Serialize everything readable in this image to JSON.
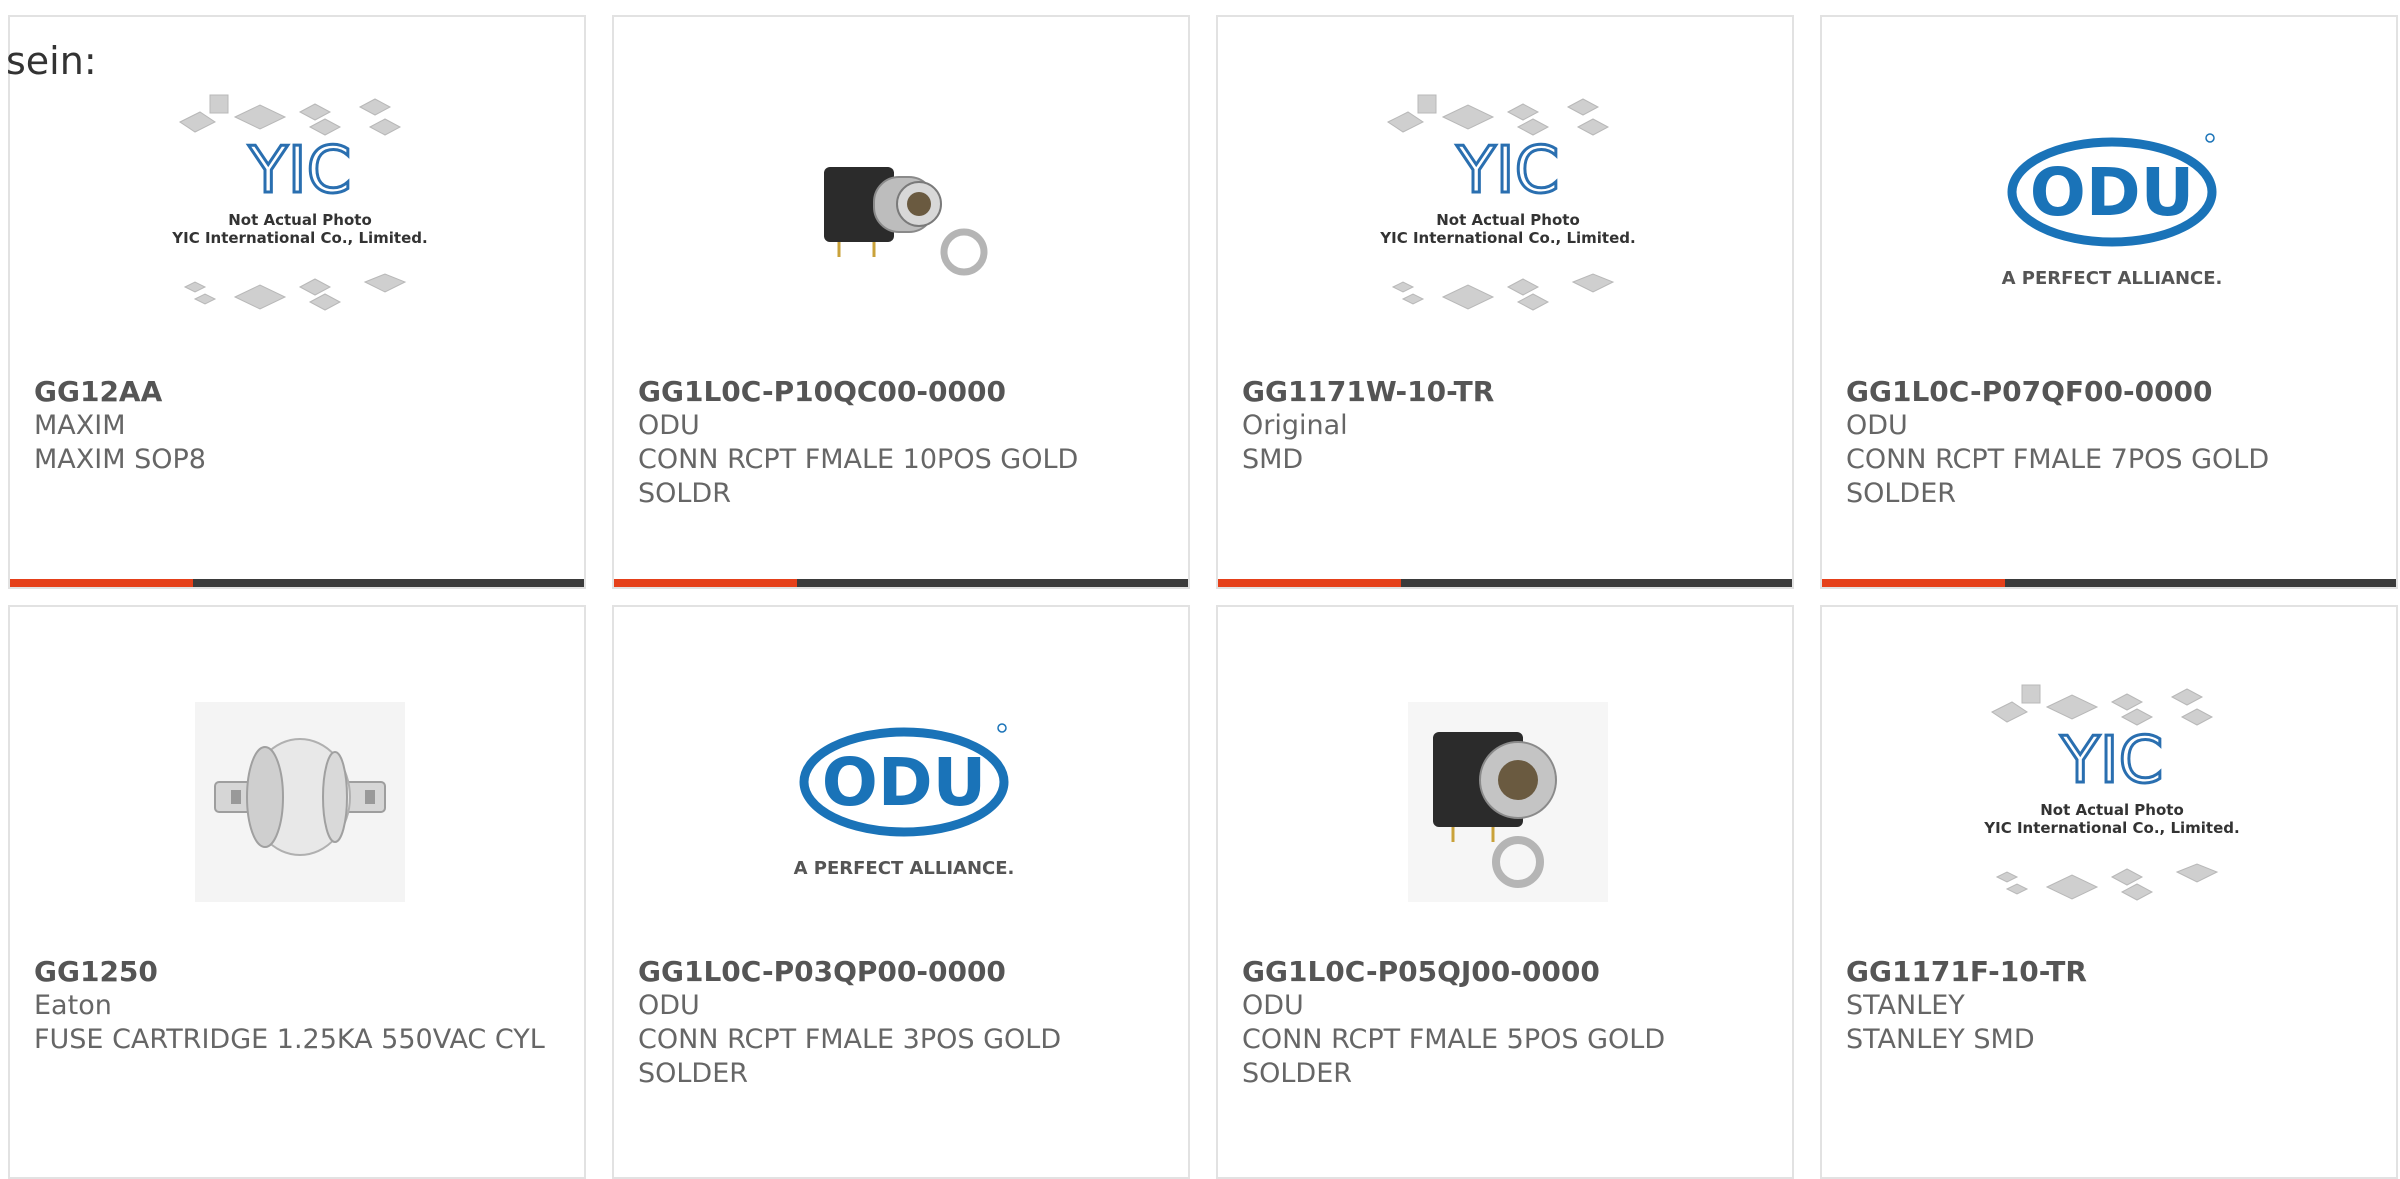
{
  "lead_text": "sein:",
  "accent_color": "#e5401a",
  "bar_color": "#3b3b3b",
  "products": [
    {
      "part_number": "GG12AA",
      "manufacturer": "MAXIM",
      "description": "MAXIM SOP8",
      "image": "yic-placeholder",
      "image_caption_1": "Not Actual Photo",
      "image_caption_2": "YIC International Co., Limited."
    },
    {
      "part_number": "GG1L0C-P10QC00-0000",
      "manufacturer": "ODU",
      "description": "CONN RCPT FMALE 10POS GOLD SOLDR",
      "image": "connector-photo"
    },
    {
      "part_number": "GG1171W-10-TR",
      "manufacturer": "Original",
      "description": "SMD",
      "image": "yic-placeholder",
      "image_caption_1": "Not Actual Photo",
      "image_caption_2": "YIC International Co., Limited."
    },
    {
      "part_number": "GG1L0C-P07QF00-0000",
      "manufacturer": "ODU",
      "description": "CONN RCPT FMALE 7POS GOLD SOLDER",
      "image": "odu-logo",
      "logo_text": "ODU",
      "logo_tagline": "A PERFECT ALLIANCE."
    },
    {
      "part_number": "GG1250",
      "manufacturer": "Eaton",
      "description": "FUSE CARTRIDGE 1.25KA 550VAC CYL",
      "image": "fuse-photo"
    },
    {
      "part_number": "GG1L0C-P03QP00-0000",
      "manufacturer": "ODU",
      "description": "CONN RCPT FMALE 3POS GOLD SOLDER",
      "image": "odu-logo",
      "logo_text": "ODU",
      "logo_tagline": "A PERFECT ALLIANCE."
    },
    {
      "part_number": "GG1L0C-P05QJ00-0000",
      "manufacturer": "ODU",
      "description": "CONN RCPT FMALE 5POS GOLD SOLDER",
      "image": "connector-photo"
    },
    {
      "part_number": "GG1171F-10-TR",
      "manufacturer": "STANLEY",
      "description": "STANLEY SMD",
      "image": "yic-placeholder",
      "image_caption_1": "Not Actual Photo",
      "image_caption_2": "YIC International Co., Limited."
    }
  ]
}
